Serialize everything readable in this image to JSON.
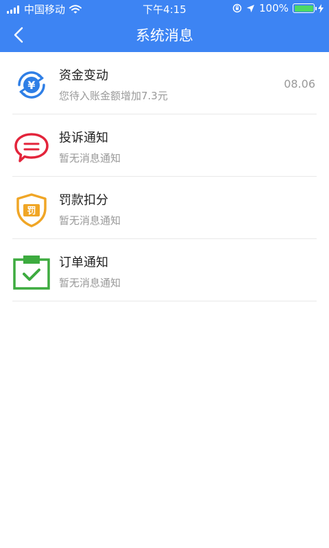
{
  "status_bar": {
    "carrier": "中国移动",
    "time": "下午4:15",
    "battery": "100%",
    "battery_level": 1.0
  },
  "header": {
    "title": "系统消息",
    "back_icon": "chevron-left-icon",
    "background": "#3d84f3"
  },
  "messages": [
    {
      "title": "资金变动",
      "subtitle": "您待入账金额增加7.3元",
      "date": "08.06",
      "icon": "money-change-icon",
      "icon_text": "¥",
      "color": "#2f7fe6"
    },
    {
      "title": "投诉通知",
      "subtitle": "暂无消息通知",
      "date": "",
      "icon": "complaint-icon",
      "color": "#e3243b"
    },
    {
      "title": "罚款扣分",
      "subtitle": "暂无消息通知",
      "date": "",
      "icon": "penalty-shield-icon",
      "icon_text": "罚",
      "color": "#f0a626"
    },
    {
      "title": "订单通知",
      "subtitle": "暂无消息通知",
      "date": "",
      "icon": "order-clipboard-icon",
      "color": "#3dab3f"
    }
  ]
}
